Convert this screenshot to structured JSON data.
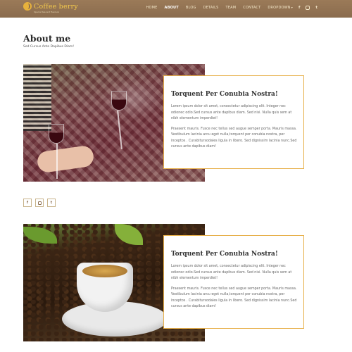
{
  "brand": {
    "name": "Coffee berry",
    "tagline": "Special tea and flavours"
  },
  "nav": {
    "items": [
      "HOME",
      "ABOUT",
      "BLOG",
      "DETAILS",
      "TEAM",
      "CONTACT",
      "DROPDOWN"
    ],
    "active": "ABOUT",
    "social": [
      "facebook-icon",
      "instagram-icon",
      "twitter-icon"
    ]
  },
  "page": {
    "title": "About me",
    "subtitle": "Sed Cursus Ante Dapibus Diam!"
  },
  "stories": [
    {
      "image": "picnic-wine-photo",
      "title": "Torquent Per Conubia Nostra!",
      "para1": "Lorem ipsum dolor sit amet, consectetur adipiscing elit. Integer nec odionec odio.Sed cursus ante dapibus diam. Sed nisi. Nulla quis sem at nibh elementum imperdiet!",
      "para2": "Praesent mauris. Fusce nec tellus sed augue semper porta. Mauris massa. Vestibulum lacinia arcu eget nulla,torquent per conubia nostra, per inceptos . Curabitursodales ligula in libero. Sed dignissim lacinia nunc.Sed cursus ante dapibus diam!"
    },
    {
      "image": "coffee-cup-photo",
      "title": "Torquent Per Conubia Nostra!",
      "para1": "Lorem ipsum dolor sit amet, consectetur adipiscing elit. Integer nec odionec odio.Sed cursus ante dapibus diam. Sed nisi. Nulla quis sem at nibh elementum imperdiet!",
      "para2": "Praesent mauris. Fusce nec tellus sed augue semper porta. Mauris massa. Vestibulum lacinia arcu eget nulla,torquent per conubia nostra, per inceptos . Curabitursodales ligula in libero. Sed dignissim lacinia nunc.Sed cursus ante dapibus diam!"
    }
  ],
  "social_row": [
    "facebook-icon",
    "instagram-icon",
    "twitter-icon"
  ],
  "glyphs": {
    "facebook": "f",
    "twitter": "t",
    "caret": "▾"
  },
  "colors": {
    "header": "#8a6c4e",
    "accent": "#e7b04a",
    "brand_text": "#f3c94c"
  }
}
